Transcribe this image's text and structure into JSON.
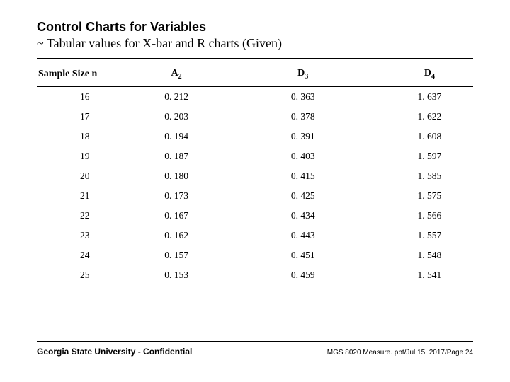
{
  "title": {
    "line1": "Control Charts for Variables",
    "line2": "~ Tabular values for X-bar and R charts (Given)"
  },
  "headers": {
    "n": "Sample Size n",
    "A": "A",
    "A_sub": "2",
    "D3": "D",
    "D3_sub": "3",
    "D4": "D",
    "D4_sub": "4"
  },
  "chart_data": {
    "type": "table",
    "title": "Tabular values for X-bar and R charts",
    "columns": [
      "Sample Size n",
      "A2",
      "D3",
      "D4"
    ],
    "rows": [
      {
        "n": "16",
        "A2": "0. 212",
        "D3": "0. 363",
        "D4": "1. 637"
      },
      {
        "n": "17",
        "A2": "0. 203",
        "D3": "0. 378",
        "D4": "1. 622"
      },
      {
        "n": "18",
        "A2": "0. 194",
        "D3": "0. 391",
        "D4": "1. 608"
      },
      {
        "n": "19",
        "A2": "0. 187",
        "D3": "0. 403",
        "D4": "1. 597"
      },
      {
        "n": "20",
        "A2": "0. 180",
        "D3": "0. 415",
        "D4": "1. 585"
      },
      {
        "n": "21",
        "A2": "0. 173",
        "D3": "0. 425",
        "D4": "1. 575"
      },
      {
        "n": "22",
        "A2": "0. 167",
        "D3": "0. 434",
        "D4": "1. 566"
      },
      {
        "n": "23",
        "A2": "0. 162",
        "D3": "0. 443",
        "D4": "1. 557"
      },
      {
        "n": "24",
        "A2": "0. 157",
        "D3": "0. 451",
        "D4": "1. 548"
      },
      {
        "n": "25",
        "A2": "0. 153",
        "D3": "0. 459",
        "D4": "1. 541"
      }
    ]
  },
  "footer": {
    "left": "Georgia State University - Confidential",
    "right": "MGS 8020 Measure. ppt/Jul 15, 2017/Page 24"
  }
}
